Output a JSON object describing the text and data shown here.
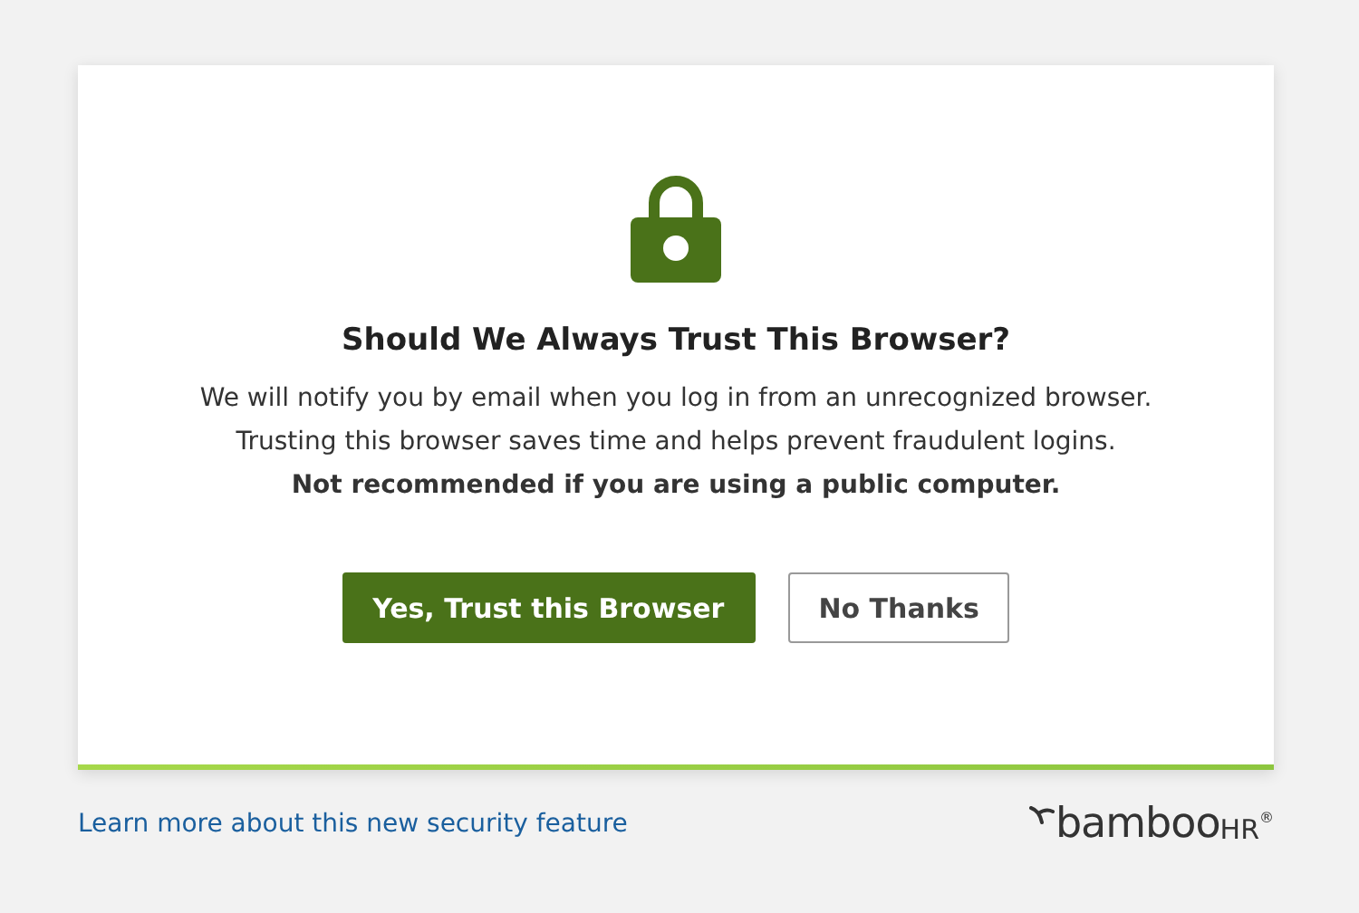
{
  "dialog": {
    "title": "Should We Always Trust This Browser?",
    "lines": [
      "We will notify you by email when you log in from an unrecognized browser.",
      "Trusting this browser saves time and helps prevent fraudulent logins."
    ],
    "warning": "Not recommended if you are using a public computer.",
    "buttons": [
      {
        "label": "Yes, Trust this Browser",
        "kind": "primary"
      },
      {
        "label": "No Thanks",
        "kind": "secondary"
      }
    ]
  },
  "footer": {
    "link": "Learn more about this new security feature",
    "logo": {
      "word": "bamboo",
      "suffix": "HR",
      "mark": "®"
    }
  }
}
